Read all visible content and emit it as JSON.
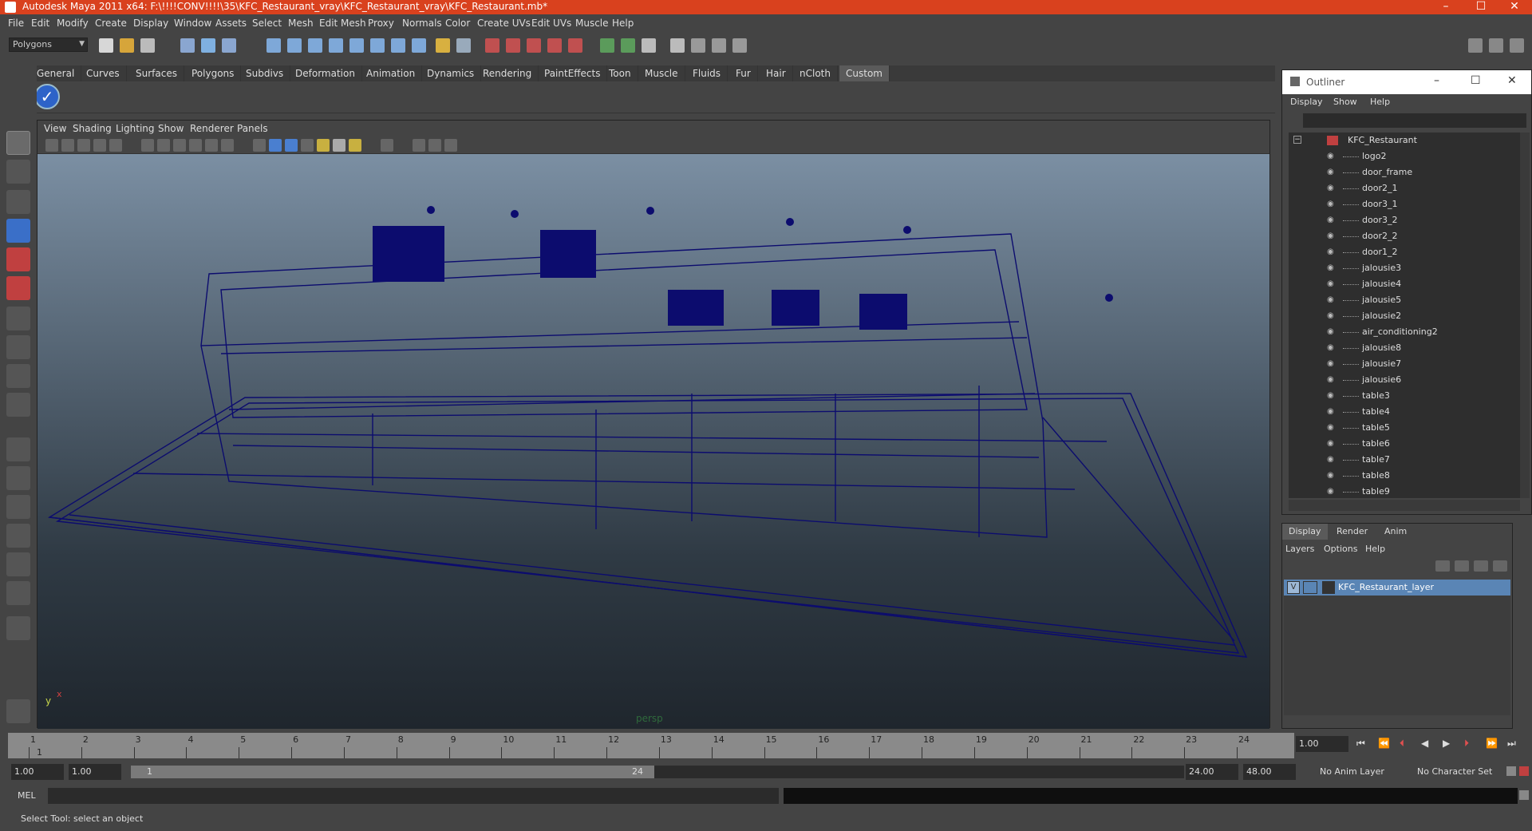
{
  "window": {
    "title": "Autodesk Maya 2011 x64: F:\\!!!!CONV!!!!\\35\\KFC_Restaurant_vray\\KFC_Restaurant_vray\\KFC_Restaurant.mb*",
    "minimize": "–",
    "maximize": "☐",
    "close": "✕"
  },
  "menubar": [
    "File",
    "Edit",
    "Modify",
    "Create",
    "Display",
    "Window",
    "Assets",
    "Select",
    "Mesh",
    "Edit Mesh",
    "Proxy",
    "Normals",
    "Color",
    "Create UVs",
    "Edit UVs",
    "Muscle",
    "Help"
  ],
  "toolbar": {
    "mode": "Polygons"
  },
  "shelf": {
    "tabs": [
      "General",
      "Curves",
      "Surfaces",
      "Polygons",
      "Subdivs",
      "Deformation",
      "Animation",
      "Dynamics",
      "Rendering",
      "PaintEffects",
      "Toon",
      "Muscle",
      "Fluids",
      "Fur",
      "Hair",
      "nCloth",
      "Custom"
    ],
    "active": "Custom"
  },
  "viewport": {
    "menu": [
      "View",
      "Shading",
      "Lighting",
      "Show",
      "Renderer",
      "Panels"
    ],
    "camera": "persp",
    "axis_y": "y",
    "axis_x": "x"
  },
  "outliner": {
    "title": "Outliner",
    "menu": [
      "Display",
      "Show",
      "Help"
    ],
    "root": "KFC_Restaurant",
    "items": [
      "logo2",
      "door_frame",
      "door2_1",
      "door3_1",
      "door3_2",
      "door2_2",
      "door1_2",
      "jalousie3",
      "jalousie4",
      "jalousie5",
      "jalousie2",
      "air_conditioning2",
      "jalousie8",
      "jalousie7",
      "jalousie6",
      "table3",
      "table4",
      "table5",
      "table6",
      "table7",
      "table8",
      "table9"
    ]
  },
  "layers": {
    "tabs": [
      "Display",
      "Render",
      "Anim"
    ],
    "active": "Display",
    "menu": [
      "Layers",
      "Options",
      "Help"
    ],
    "rows": [
      {
        "visible": "V",
        "name": "KFC_Restaurant_layer"
      }
    ]
  },
  "timeline": {
    "ticks": [
      "1",
      "2",
      "3",
      "4",
      "5",
      "6",
      "7",
      "8",
      "9",
      "10",
      "11",
      "12",
      "13",
      "14",
      "15",
      "16",
      "17",
      "18",
      "19",
      "20",
      "21",
      "22",
      "23",
      "24"
    ],
    "current": "1",
    "current_field": "1.00"
  },
  "range": {
    "start": "1.00",
    "anim_start": "1.00",
    "slider_start": "1",
    "slider_end": "24",
    "end": "24.00",
    "anim_end": "48.00",
    "anim_layer": "No Anim Layer",
    "character_set": "No Character Set"
  },
  "command": {
    "label": "MEL"
  },
  "status": {
    "help": "Select Tool: select an object"
  },
  "colors": {
    "titlebar": "#d9411e",
    "wire": "#0c0c6e",
    "selection": "#5a85b5"
  }
}
